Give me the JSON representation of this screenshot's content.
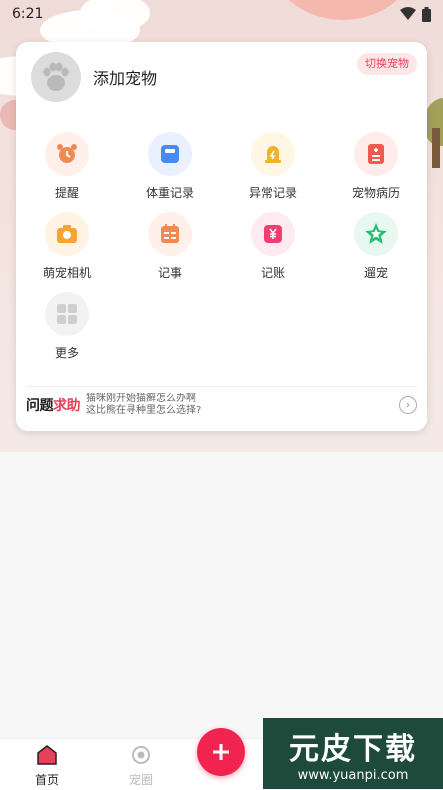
{
  "status_bar": {
    "time": "6:21"
  },
  "pet_card": {
    "add_pet": "添加宠物",
    "switch_pet": "切换宠物"
  },
  "features": [
    {
      "label": "提醒",
      "icon": "alarm-clock-icon",
      "bg": "#fff1ea",
      "fg": "#f08a55"
    },
    {
      "label": "体重记录",
      "icon": "scale-icon",
      "bg": "#eaf0fd",
      "fg": "#4a8af0"
    },
    {
      "label": "异常记录",
      "icon": "warning-lamp-icon",
      "bg": "#fff6e4",
      "fg": "#f2b12d"
    },
    {
      "label": "宠物病历",
      "icon": "medical-record-icon",
      "bg": "#ffeceb",
      "fg": "#ef5a4f"
    },
    {
      "label": "萌宠相机",
      "icon": "camera-icon",
      "bg": "#fff3e3",
      "fg": "#f7a532"
    },
    {
      "label": "记事",
      "icon": "notebook-icon",
      "bg": "#fff1ea",
      "fg": "#f08a55"
    },
    {
      "label": "记账",
      "icon": "ledger-icon",
      "bg": "#feeaf0",
      "fg": "#ee3f72"
    },
    {
      "label": "遛宠",
      "icon": "walk-star-icon",
      "bg": "#e6f8ef",
      "fg": "#23c071"
    },
    {
      "label": "更多",
      "icon": "more-grid-icon",
      "bg": "#f2f2f2",
      "fg": "#cfcfcf"
    }
  ],
  "help": {
    "logo_a": "问题",
    "logo_b": "求助",
    "line1": "猫咪刚开始猫癣怎么办啊",
    "line2": "这比熊在寻种里怎么选择?"
  },
  "tabs": [
    {
      "label": "首页",
      "active": true
    },
    {
      "label": "宠圈",
      "active": false
    }
  ],
  "watermark": {
    "title": "元皮下载",
    "url": "www.yuanpi.com"
  },
  "colors": {
    "accent": "#f0244f",
    "tab_active": "#222222",
    "tab_inactive": "#bbbbbb"
  }
}
